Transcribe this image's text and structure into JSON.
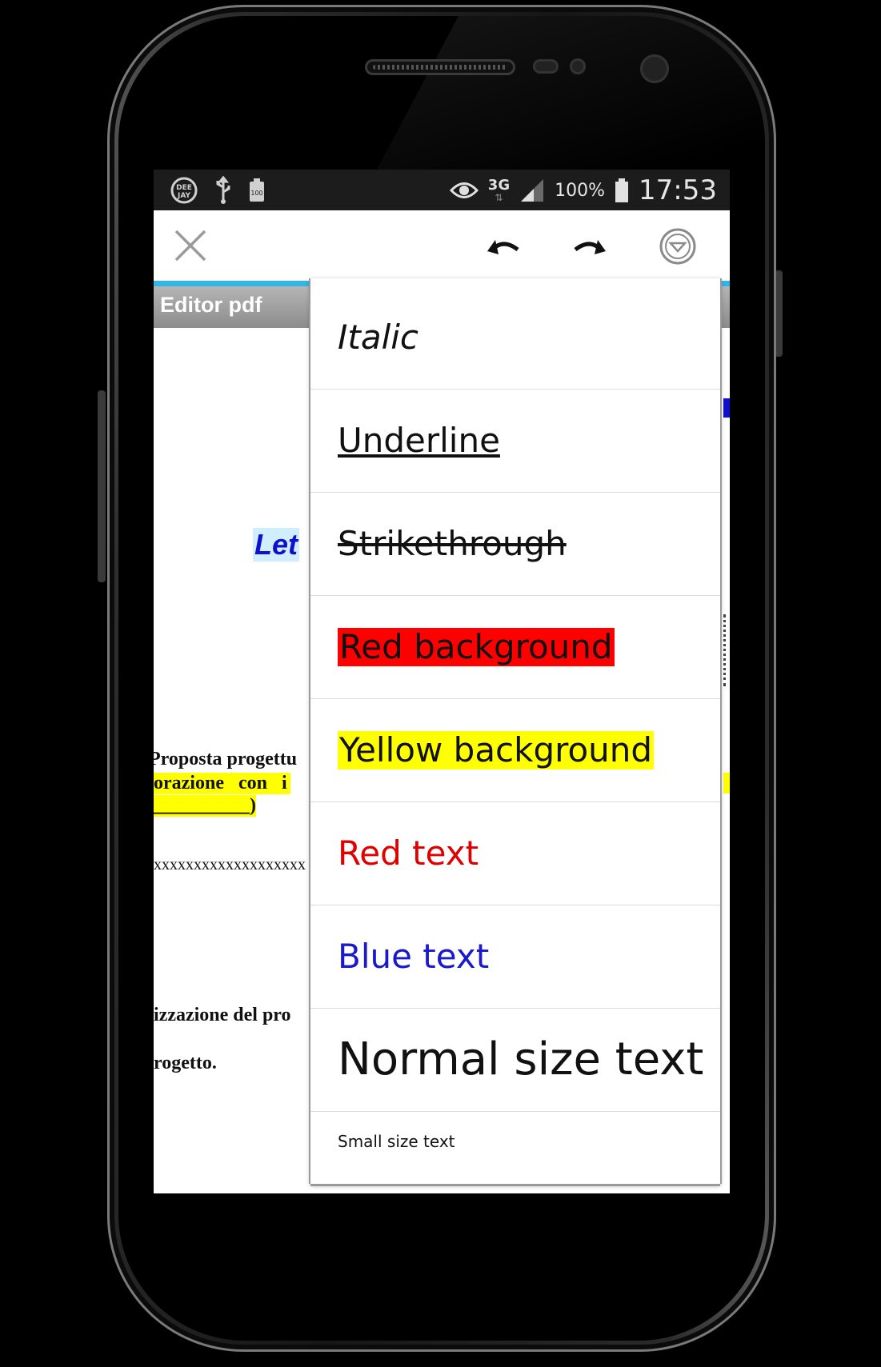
{
  "statusbar": {
    "left_icons": [
      "deejay-icon",
      "usb-icon",
      "battery-saver-icon"
    ],
    "deejay_label": "DEE JAY",
    "battery_small_label": "100",
    "network": "3G",
    "battery_percent": "100%",
    "time": "17:53"
  },
  "toolbar": {
    "close_icon": "close-icon",
    "undo_icon": "undo-icon",
    "redo_icon": "redo-icon",
    "dropdown_icon": "chevron-down-circle-icon"
  },
  "document": {
    "tab_title": "Editor pdf",
    "heading_fragment": "Let",
    "lines": [
      "Proposta progettu",
      "orazione   con   i",
      "__________)",
      "xxxxxxxxxxxxxxxxxxx",
      "izzazione del pro",
      "rogetto."
    ]
  },
  "menu": {
    "items": [
      {
        "label": "Italic",
        "style": "italic"
      },
      {
        "label": "Underline",
        "style": "underline"
      },
      {
        "label": "Strikethrough",
        "style": "strikethrough"
      },
      {
        "label": "Red background",
        "style": "red-background"
      },
      {
        "label": "Yellow background",
        "style": "yellow-background"
      },
      {
        "label": "Red text",
        "style": "red-text"
      },
      {
        "label": "Blue text",
        "style": "blue-text"
      },
      {
        "label": "Normal size text",
        "style": "normal-size"
      },
      {
        "label": "Small size text",
        "style": "small-size"
      }
    ]
  },
  "colors": {
    "accent": "#33b5e5",
    "red": "#ff0000",
    "yellow": "#ffff00",
    "red_text": "#e00000",
    "blue_text": "#1a1acc",
    "doc_blue": "#1010cc",
    "doc_highlight": "#ffff00"
  }
}
